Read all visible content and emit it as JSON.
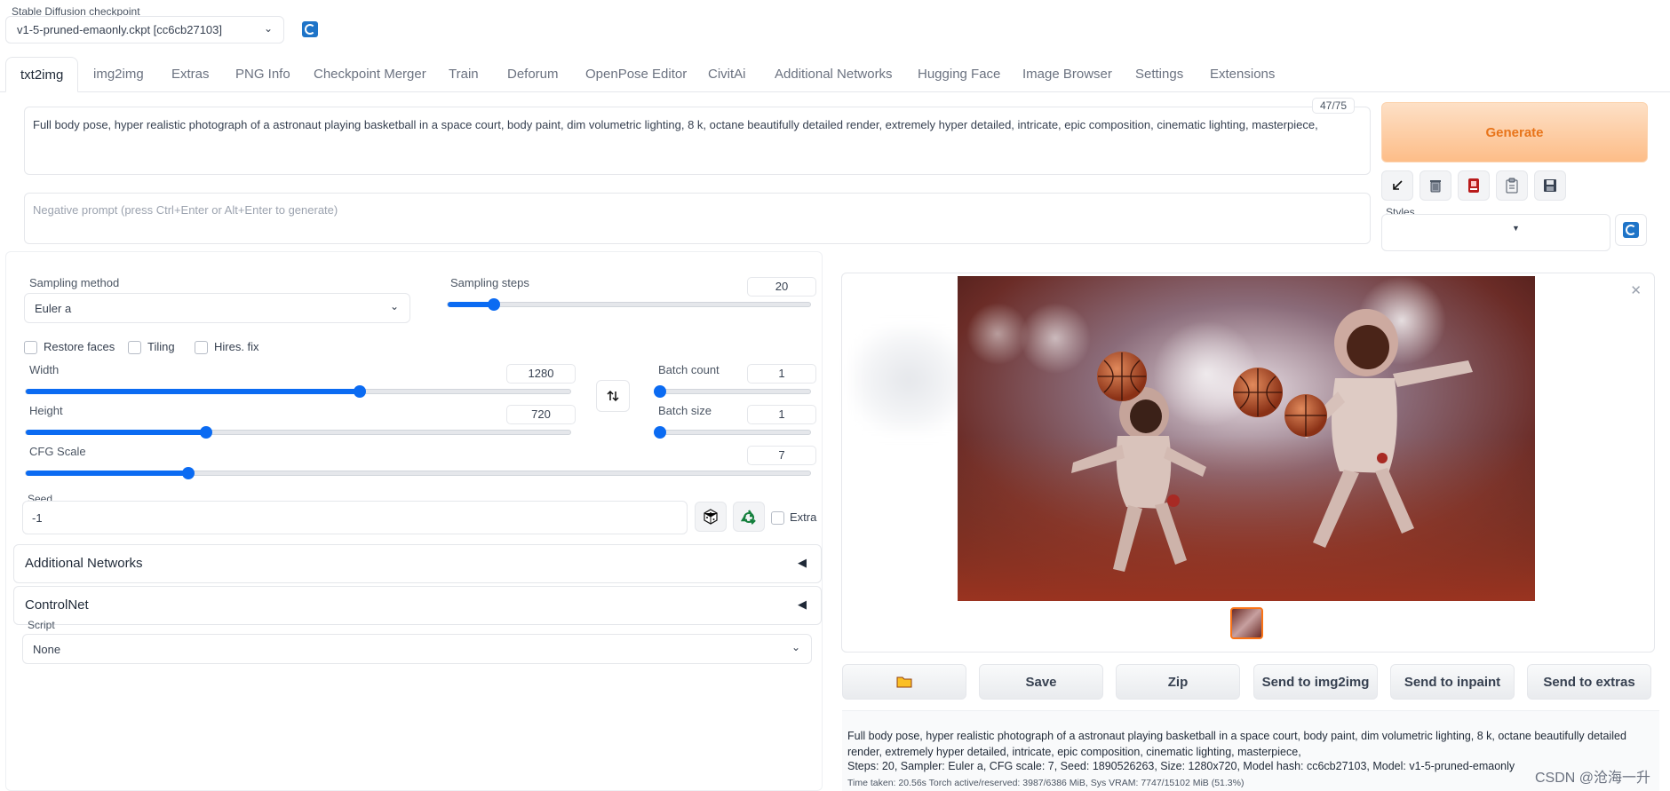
{
  "checkpoint": {
    "label": "Stable Diffusion checkpoint",
    "value": "v1-5-pruned-emaonly.ckpt [cc6cb27103]"
  },
  "tabs": [
    {
      "label": "txt2img",
      "active": true
    },
    {
      "label": "img2img"
    },
    {
      "label": "Extras"
    },
    {
      "label": "PNG Info"
    },
    {
      "label": "Checkpoint Merger"
    },
    {
      "label": "Train"
    },
    {
      "label": "Deforum"
    },
    {
      "label": "OpenPose Editor"
    },
    {
      "label": "CivitAi"
    },
    {
      "label": "Additional Networks"
    },
    {
      "label": "Hugging Face"
    },
    {
      "label": "Image Browser"
    },
    {
      "label": "Settings"
    },
    {
      "label": "Extensions"
    }
  ],
  "prompt": {
    "value": "Full body pose, hyper realistic photograph of a astronaut playing basketball in a space court, body paint, dim volumetric lighting, 8 k, octane beautifully detailed render, extremely hyper detailed, intricate, epic composition, cinematic lighting, masterpiece,",
    "token_count": "47/75"
  },
  "negative_prompt": {
    "placeholder": "Negative prompt (press Ctrl+Enter or Alt+Enter to generate)"
  },
  "generate_label": "Generate",
  "styles_label": "Styles",
  "sampling": {
    "method_label": "Sampling method",
    "method_value": "Euler a",
    "steps_label": "Sampling steps",
    "steps_value": "20",
    "steps_min": 1,
    "steps_max": 150
  },
  "checkboxes": {
    "restore_faces": "Restore faces",
    "tiling": "Tiling",
    "hires_fix": "Hires. fix"
  },
  "width": {
    "label": "Width",
    "value": "1280",
    "min": 64,
    "max": 2048
  },
  "height": {
    "label": "Height",
    "value": "720",
    "min": 64,
    "max": 2048
  },
  "batch_count": {
    "label": "Batch count",
    "value": "1"
  },
  "batch_size": {
    "label": "Batch size",
    "value": "1"
  },
  "cfg": {
    "label": "CFG Scale",
    "value": "7",
    "min": 1,
    "max": 30
  },
  "seed": {
    "label": "Seed",
    "value": "-1",
    "extra_label": "Extra"
  },
  "accordions": {
    "additional_networks": "Additional Networks",
    "controlnet": "ControlNet"
  },
  "script": {
    "label": "Script",
    "value": "None"
  },
  "output_buttons": {
    "save": "Save",
    "zip": "Zip",
    "send_img2img": "Send to img2img",
    "send_inpaint": "Send to inpaint",
    "send_extras": "Send to extras"
  },
  "info": {
    "prompt": "Full body pose, hyper realistic photograph of a astronaut playing basketball in a space court, body paint, dim volumetric lighting, 8 k, octane beautifully detailed render, extremely hyper detailed, intricate, epic composition, cinematic lighting, masterpiece,",
    "params": "Steps: 20, Sampler: Euler a, CFG scale: 7, Seed: 1890526263, Size: 1280x720, Model hash: cc6cb27103, Model: v1-5-pruned-emaonly",
    "time": "Time taken: 20.56s  Torch active/reserved: 3987/6386 MiB, Sys VRAM: 7747/15102 MiB (51.3%)"
  },
  "watermark": "CSDN @沧海一升",
  "colors": {
    "accent": "#0b6bf2",
    "generate_bg": "#fdc89b",
    "generate_text": "#e8741a"
  }
}
